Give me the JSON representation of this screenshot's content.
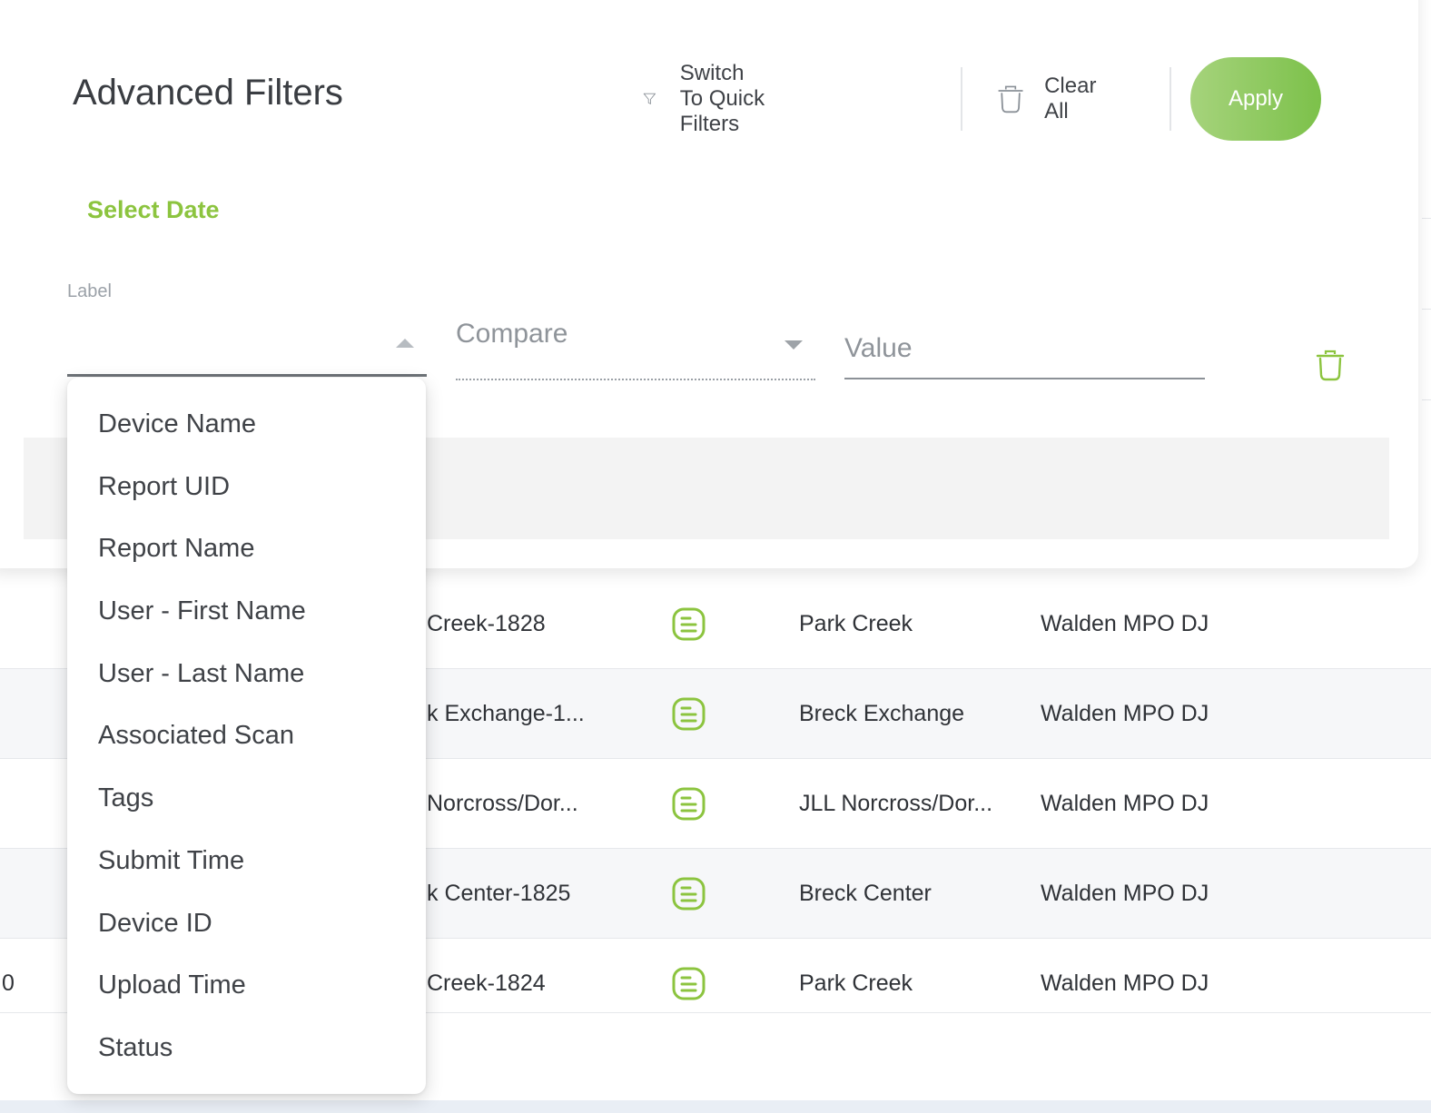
{
  "filters": {
    "title": "Advanced Filters",
    "switch_label": "Switch To Quick Filters",
    "clear_all_label": "Clear All",
    "apply_label": "Apply",
    "select_date_label": "Select Date",
    "label_field_label": "Label",
    "compare_placeholder": "Compare",
    "value_placeholder": "Value",
    "accent_color": "#8cc43f"
  },
  "label_options": [
    "Device Name",
    "Report UID",
    "Report Name",
    "User - First Name",
    "User - Last Name",
    "Associated Scan",
    "Tags",
    "Submit Time",
    "Device ID",
    "Upload Time",
    "Status"
  ],
  "table_rows": [
    {
      "id": "",
      "name": "Creek-1828",
      "site": "Park Creek",
      "user": "Walden MPO DJ",
      "icon": "report-doc-icon"
    },
    {
      "id": "",
      "name": "k Exchange-1...",
      "site": "Breck Exchange",
      "user": "Walden MPO DJ",
      "icon": "report-doc-icon"
    },
    {
      "id": "",
      "name": "Norcross/Dor...",
      "site": "JLL Norcross/Dor...",
      "user": "Walden MPO DJ",
      "icon": "report-doc-icon"
    },
    {
      "id": "",
      "name": "k Center-1825",
      "site": "Breck Center",
      "user": "Walden MPO DJ",
      "icon": "report-doc-icon"
    },
    {
      "id": "0",
      "name": "Creek-1824",
      "site": "Park Creek",
      "user": "Walden MPO DJ",
      "icon": "report-doc-icon"
    }
  ]
}
